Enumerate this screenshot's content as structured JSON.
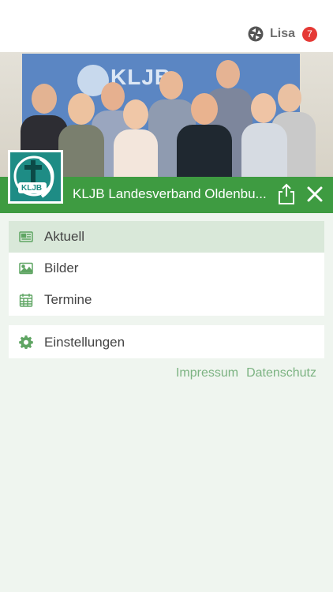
{
  "header": {
    "user_name": "Lisa",
    "notification_count": "7",
    "user_icon": "app-logo-icon"
  },
  "hero": {
    "banner_text": "KLJB",
    "banner_logo_text": "KLJB"
  },
  "org": {
    "title": "KLJB Landesverband Oldenbu...",
    "logo_text": "KLJB",
    "share_icon": "share-icon",
    "close_icon": "close-icon"
  },
  "menu": {
    "items": [
      {
        "label": "Aktuell",
        "icon": "newspaper-icon",
        "active": true
      },
      {
        "label": "Bilder",
        "icon": "image-icon",
        "active": false
      },
      {
        "label": "Termine",
        "icon": "calendar-icon",
        "active": false
      }
    ],
    "settings": {
      "label": "Einstellungen",
      "icon": "gear-icon"
    }
  },
  "footer": {
    "impressum": "Impressum",
    "datenschutz": "Datenschutz"
  },
  "colors": {
    "brand_green": "#3e9b41",
    "active_bg": "#d9e8d9",
    "badge_red": "#e53935",
    "link_green": "#7cb382",
    "icon_green": "#5fa563"
  }
}
